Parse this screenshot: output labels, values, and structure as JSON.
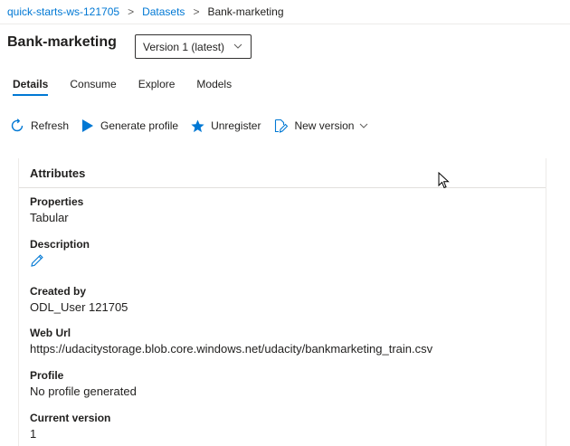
{
  "breadcrumb": {
    "items": [
      "quick-starts-ws-121705",
      "Datasets"
    ],
    "current": "Bank-marketing"
  },
  "header": {
    "title": "Bank-marketing",
    "version_select": "Version 1 (latest)"
  },
  "tabs": [
    {
      "label": "Details",
      "active": true
    },
    {
      "label": "Consume",
      "active": false
    },
    {
      "label": "Explore",
      "active": false
    },
    {
      "label": "Models",
      "active": false
    }
  ],
  "toolbar": {
    "refresh": "Refresh",
    "generate_profile": "Generate profile",
    "unregister": "Unregister",
    "new_version": "New version"
  },
  "attributes": {
    "title": "Attributes",
    "properties_label": "Properties",
    "properties_value": "Tabular",
    "description_label": "Description",
    "created_by_label": "Created by",
    "created_by_value": "ODL_User 121705",
    "web_url_label": "Web Url",
    "web_url_value": "https://udacitystorage.blob.core.windows.net/udacity/bankmarketing_train.csv",
    "profile_label": "Profile",
    "profile_value": "No profile generated",
    "current_version_label": "Current version",
    "current_version_value": "1"
  },
  "colors": {
    "accent": "#0078d4",
    "text": "#201f1e"
  }
}
